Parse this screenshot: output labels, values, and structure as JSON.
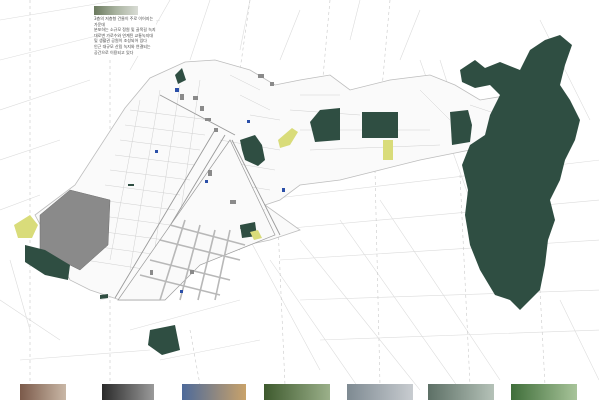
{
  "colors": {
    "park": "#2f4e42",
    "highlight": "#d9dc7a",
    "building_gray": "#8a8a8a",
    "water_blue": "#2b4fa8",
    "street_line": "#d7d7d7"
  },
  "callout": {
    "lines": [
      "3층의 저층형 건물이 주로 이어지는 가운데",
      "분포하는 소규모 정원 및 골목길 녹지",
      "대로변 가로수와 연계된 교통녹지대",
      "및 생활권 공원이 조성되어 있다",
      "인근 대규모 산림 녹지와 연결되는",
      "공간으로 이용되고 있다"
    ]
  },
  "photos": [
    {
      "id": "photo-1",
      "colors": [
        "#7b5a4a",
        "#c9b7a6"
      ]
    },
    {
      "id": "photo-2",
      "colors": [
        "#2a2a2a",
        "#9a9a9a"
      ]
    },
    {
      "id": "photo-3",
      "colors": [
        "#4d6a9a",
        "#c9a26a"
      ]
    },
    {
      "id": "photo-4",
      "colors": [
        "#3e5a2e",
        "#9bb08a"
      ]
    },
    {
      "id": "photo-5",
      "colors": [
        "#7e8a92",
        "#c8ccd0"
      ]
    },
    {
      "id": "photo-6",
      "colors": [
        "#5d7066",
        "#b5c2b8"
      ]
    },
    {
      "id": "photo-7",
      "colors": [
        "#3f6e3a",
        "#a8c49a"
      ]
    }
  ]
}
